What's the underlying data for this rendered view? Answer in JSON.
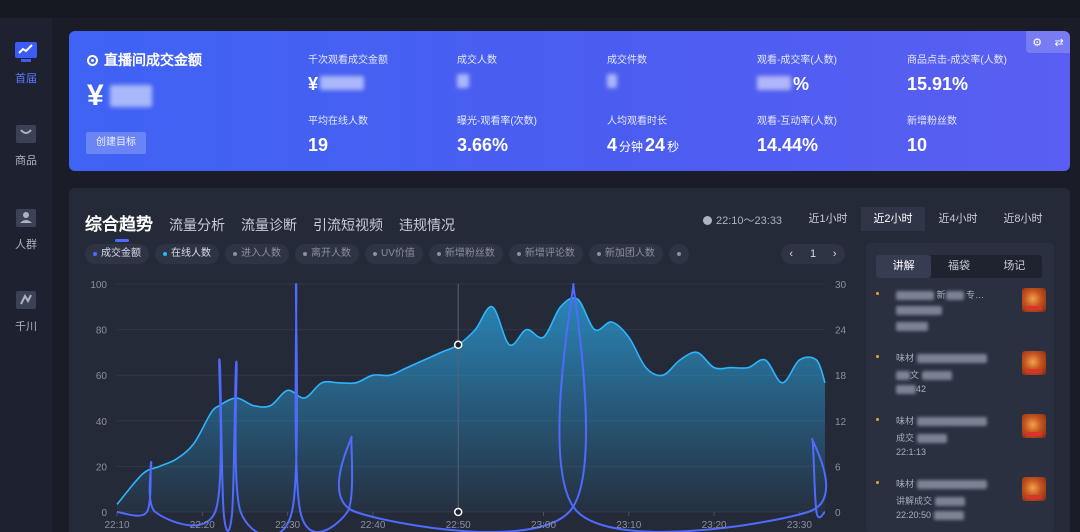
{
  "sidebar": {
    "items": [
      {
        "label": "首届",
        "icon": "home-chart-icon",
        "active": true
      },
      {
        "label": "商品",
        "icon": "product-icon",
        "active": false
      },
      {
        "label": "人群",
        "icon": "audience-icon",
        "active": false
      },
      {
        "label": "千川",
        "icon": "qianchuan-icon",
        "active": false
      }
    ]
  },
  "hero": {
    "title": "直播间成交金额",
    "currency": "¥",
    "goal_button": "创建目标",
    "metrics": [
      {
        "label": "千次观看成交金额",
        "value": "¥",
        "blurred": true
      },
      {
        "label": "成交人数",
        "value": "",
        "blurred": true
      },
      {
        "label": "成交件数",
        "value": "",
        "blurred": true
      },
      {
        "label": "观看-成交率(人数)",
        "value": "%",
        "blurred": true
      },
      {
        "label": "商品点击-成交率(人数)",
        "value": "15.91%",
        "blurred": false
      },
      {
        "label": "平均在线人数",
        "value": "19",
        "blurred": false
      },
      {
        "label": "曝光-观看率(次数)",
        "value": "3.66%",
        "blurred": false
      },
      {
        "label": "人均观看时长",
        "value_min": "4",
        "unit_min": "分钟",
        "value_sec": "24",
        "unit_sec": "秒"
      },
      {
        "label": "观看-互动率(人数)",
        "value": "14.44%",
        "blurred": false
      },
      {
        "label": "新增粉丝数",
        "value": "10",
        "blurred": false
      }
    ]
  },
  "main": {
    "tabs": [
      "综合趋势",
      "流量分析",
      "流量诊断",
      "引流短视频",
      "违规情况"
    ],
    "active_tab": 0,
    "time_range": "22:10～23:33",
    "range_buttons": [
      "近1小时",
      "近2小时",
      "近4小时",
      "近8小时"
    ],
    "active_range": 1,
    "chips": [
      {
        "label": "成交金额",
        "on": true
      },
      {
        "label": "在线人数",
        "on": true
      },
      {
        "label": "进入人数",
        "on": false
      },
      {
        "label": "离开人数",
        "on": false
      },
      {
        "label": "UV价值",
        "on": false
      },
      {
        "label": "新增粉丝数",
        "on": false
      },
      {
        "label": "新增评论数",
        "on": false
      },
      {
        "label": "新加团人数",
        "on": false
      }
    ],
    "pager": {
      "prev": "‹",
      "page": "1",
      "next": "›"
    }
  },
  "chart_data": {
    "type": "area",
    "x_ticks": [
      "22:10",
      "22:20",
      "22:30",
      "22:40",
      "22:50",
      "23:00",
      "23:10",
      "23:20",
      "23:30"
    ],
    "y_left_ticks": [
      "0",
      "20",
      "40",
      "60",
      "80",
      "100"
    ],
    "y_right_ticks": [
      "0",
      "6",
      "12",
      "18",
      "24",
      "30"
    ],
    "ylim_left": [
      0,
      100
    ],
    "ylim_right": [
      0,
      30
    ],
    "x_range_minutes": [
      0,
      83
    ],
    "series": [
      {
        "axis": "right",
        "color": "#2db5ff",
        "x": [
          0,
          3,
          5,
          7,
          9,
          11,
          12,
          14,
          16,
          18,
          20,
          22,
          24,
          26,
          28,
          30,
          32,
          34,
          36,
          38,
          40,
          42,
          44,
          46,
          48,
          50,
          52,
          54,
          56,
          58,
          60,
          62,
          64,
          66,
          68,
          70,
          72,
          74,
          76,
          78,
          80,
          82,
          83
        ],
        "y": [
          1,
          5,
          6,
          7,
          9,
          13,
          14,
          15,
          14,
          14,
          16,
          15,
          17,
          17,
          17,
          18,
          18,
          19,
          20,
          21,
          22,
          24,
          27,
          22,
          24,
          23,
          27,
          28,
          24,
          25,
          23,
          19,
          18,
          20,
          21,
          19,
          19,
          19,
          20,
          17,
          20,
          20,
          17
        ]
      },
      {
        "axis": "left",
        "color": "#4f6bff",
        "x": [
          0,
          3.5,
          4,
          4.5,
          11.5,
          12,
          12.5,
          13.5,
          14,
          14.5,
          20.5,
          21,
          21.5,
          27,
          27.5,
          28,
          53,
          53.5,
          54,
          81,
          81.5,
          82,
          83
        ],
        "y": [
          0,
          0,
          22,
          0,
          0,
          67,
          0,
          0,
          66,
          0,
          0,
          100,
          0,
          0,
          33,
          0,
          0,
          100,
          0,
          0,
          32,
          0,
          0
        ]
      }
    ],
    "cursor_x": 40
  },
  "side": {
    "tabs": [
      "讲解",
      "福袋",
      "场记"
    ],
    "active_tab": 0,
    "items": [
      {
        "l1": "新",
        "l1b": "专",
        "l2": "",
        "l3": ""
      },
      {
        "l1": "味材",
        "l2": "文",
        "l3": "42"
      },
      {
        "l1": "味材",
        "l2": "成交",
        "l3": "22:1:13"
      },
      {
        "l1": "味材",
        "l2": "讲解成交",
        "l3": "22:20:50"
      }
    ]
  }
}
